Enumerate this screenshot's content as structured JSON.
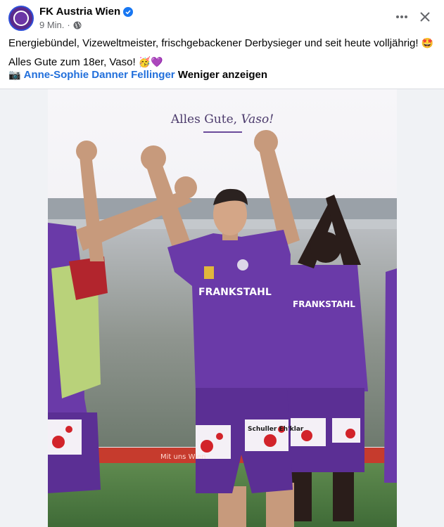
{
  "page": {
    "name": "FK Austria Wien",
    "time": "9 Min.",
    "separator": "·"
  },
  "post": {
    "line1": "Energiebündel, Vizeweltmeister, frischgebackener Derbysieger und seit heute volljährig!",
    "line1_emoji": "🤩",
    "line2": "Alles Gute zum 18er, Vaso!",
    "line2_emoji": "🥳💜",
    "camera_emoji": "📷",
    "photo_credit": "Anne-Sophie Danner Fellinger",
    "show_less": "Weniger anzeigen"
  },
  "photo": {
    "caption_main": "Alles Gute,",
    "caption_name": "Vaso!",
    "sponsor_shirt": "FRANKSTAHL",
    "sponsor_shorts": "Schuller Eh'klar",
    "board_text": "Mit uns Wien"
  },
  "icons": {
    "verified": "verified-badge-icon",
    "globe": "globe-icon",
    "more": "more-options-icon",
    "close": "close-icon"
  },
  "colors": {
    "link": "#216fdb",
    "verified": "#1877f2",
    "kit_purple": "#6a3aa8"
  }
}
